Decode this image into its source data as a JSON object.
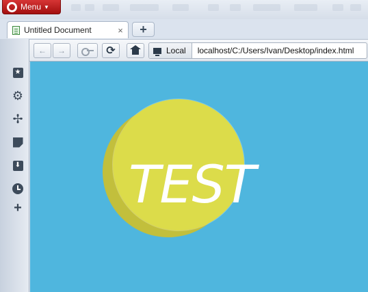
{
  "browser": {
    "menu_label": "Menu",
    "tab": {
      "title": "Untitled Document",
      "close_glyph": "×"
    },
    "new_tab_glyph": "+",
    "toolbar": {
      "back_glyph": "←",
      "forward_glyph": "→",
      "reload_glyph": "⟳",
      "address": {
        "security_label": "Local",
        "url": "localhost/C:/Users/Ivan/Desktop/index.html"
      }
    },
    "sidebar": {
      "items": [
        {
          "icon": "bookmarks-icon",
          "glyph": "★"
        },
        {
          "icon": "extensions-gear-icon",
          "glyph": "⚙"
        },
        {
          "icon": "unite-fan-icon",
          "glyph": "✢"
        },
        {
          "icon": "notes-icon"
        },
        {
          "icon": "downloads-icon",
          "glyph": "⬇"
        },
        {
          "icon": "history-clock-icon"
        },
        {
          "icon": "add-panel-icon",
          "glyph": "+"
        }
      ]
    }
  },
  "page": {
    "heading_text": "TEST",
    "colors": {
      "background": "#4fb6de",
      "circle": "#dcdc4a",
      "circle_shadow": "#c2bf3c",
      "text": "#ffffff"
    }
  }
}
